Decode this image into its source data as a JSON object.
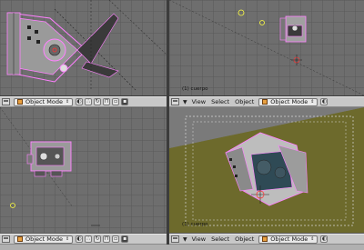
{
  "viewports": {
    "top_left": {
      "header": {
        "mode": "Object Mode"
      }
    },
    "top_right": {
      "object_label": "(1) cuerpo",
      "header": {
        "menu": [
          "View",
          "Select",
          "Object"
        ],
        "mode": "Object Mode"
      }
    },
    "bottom_left": {
      "header": {
        "mode": "Object Mode"
      }
    },
    "bottom_right": {
      "object_label": "(1) cuerpo",
      "header": {
        "menu": [
          "View",
          "Select",
          "Object"
        ],
        "mode": "Object Mode"
      }
    }
  },
  "colors": {
    "grid": "#6e6e6e",
    "floor": "#6d6a2c",
    "selection": "#ff80ff",
    "header": "#c8c8c8"
  }
}
